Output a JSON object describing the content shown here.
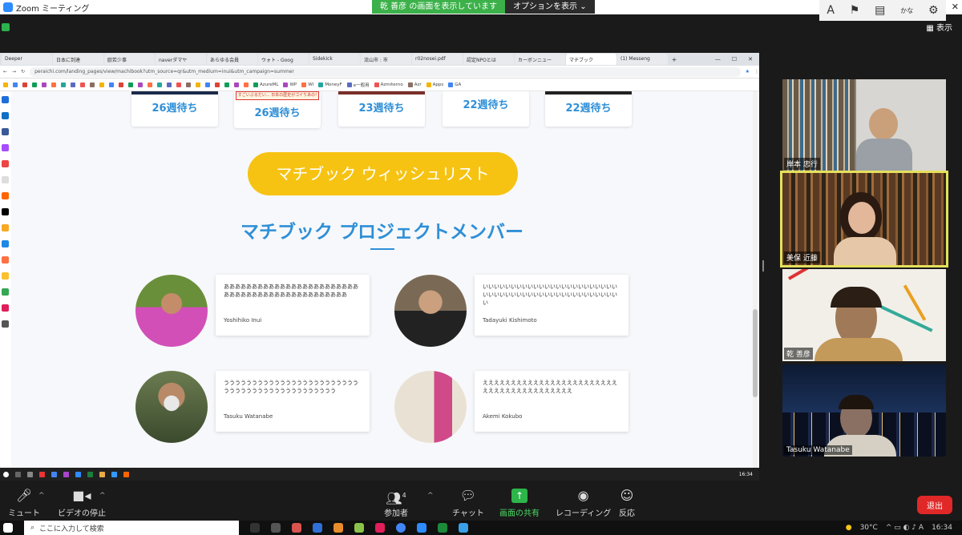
{
  "window": {
    "title": "Zoom ミーティング"
  },
  "share_banner": {
    "sharing_text": "乾 善彦 の画面を表示しています",
    "options_label": "オプションを表示 ⌄"
  },
  "view_label": "表示",
  "browser": {
    "tabs": [
      "Deeper",
      "日本に到達",
      "欧若少事",
      "naverダマヤ",
      "あらゆる会員",
      "ウォト - Goog",
      "Sidekick",
      "流山市 : 市",
      "r02nosei.pdf",
      "認定NPOとは",
      "カーボンニュー",
      "マチブック",
      "(1) Messeng"
    ],
    "url": "peraichi.com/landing_pages/view/machibook?utm_source=qr&utm_medium=inui&utm_campaign=summer",
    "bookmarks": [
      "AzureML",
      "WP",
      "WI",
      "MoneyF",
      "e一般用",
      "Azmiterno",
      "Azr",
      "Apps",
      "GA"
    ]
  },
  "page": {
    "waits": [
      "26週待ち",
      "26週待ち",
      "23週待ち",
      "22週待ち",
      "22週待ち"
    ],
    "banner_text": "すごいぶるだい... 日本の歴史がゴイりあの!",
    "wishlist_button": "マチブック ウィッシュリスト",
    "section_title": "マチブック プロジェクトメンバー",
    "members": [
      {
        "text": "ああああああああああああああああああああああああああああああああああああああああああああああ",
        "name": "Yoshihiko Inui"
      },
      {
        "text": "いいいいいいいいいいいいいいいいいいいいいいいいいいいいいいいいいいいいいいいいいいいいいいいいい",
        "name": "Tadayuki Kishimoto"
      },
      {
        "text": "うううううううううううううううううううううううううううううううううううううううううううう",
        "name": "Tasuku Watanabe"
      },
      {
        "text": "ええええええええええええええええええええええええええええええええええええええええ",
        "name": "Akemi Kokubo"
      }
    ]
  },
  "screen_clock": "16:34",
  "participants": [
    {
      "name": "岸本 忠行"
    },
    {
      "name": "美保 近藤"
    },
    {
      "name": "乾 善彦"
    },
    {
      "name": "Tasuku Watanabe"
    }
  ],
  "toolbar": {
    "mute": "ミュート",
    "video": "ビデオの停止",
    "participants": "参加者",
    "participants_count": "4",
    "chat": "チャット",
    "share": "画面の共有",
    "record": "レコーディング",
    "reactions": "反応",
    "exit": "退出"
  },
  "taskbar": {
    "search_placeholder": "ここに入力して検索",
    "temp": "30°C",
    "clock": "16:34"
  }
}
